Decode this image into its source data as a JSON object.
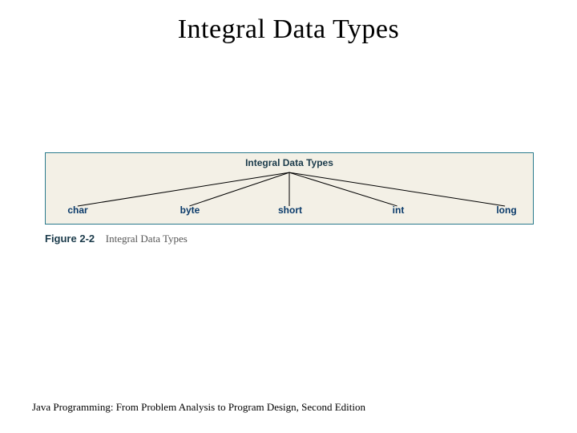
{
  "title": "Integral Data Types",
  "figure": {
    "header": "Integral Data Types",
    "leaves": [
      "char",
      "byte",
      "short",
      "int",
      "long"
    ],
    "caption_num": "Figure 2-2",
    "caption_text": "Integral Data Types"
  },
  "footer": "Java Programming: From Problem Analysis to Program Design, Second Edition",
  "colors": {
    "box_border": "#2a7a8c",
    "box_bg": "#f3f0e6",
    "leaf_color": "#0a3a6a"
  }
}
